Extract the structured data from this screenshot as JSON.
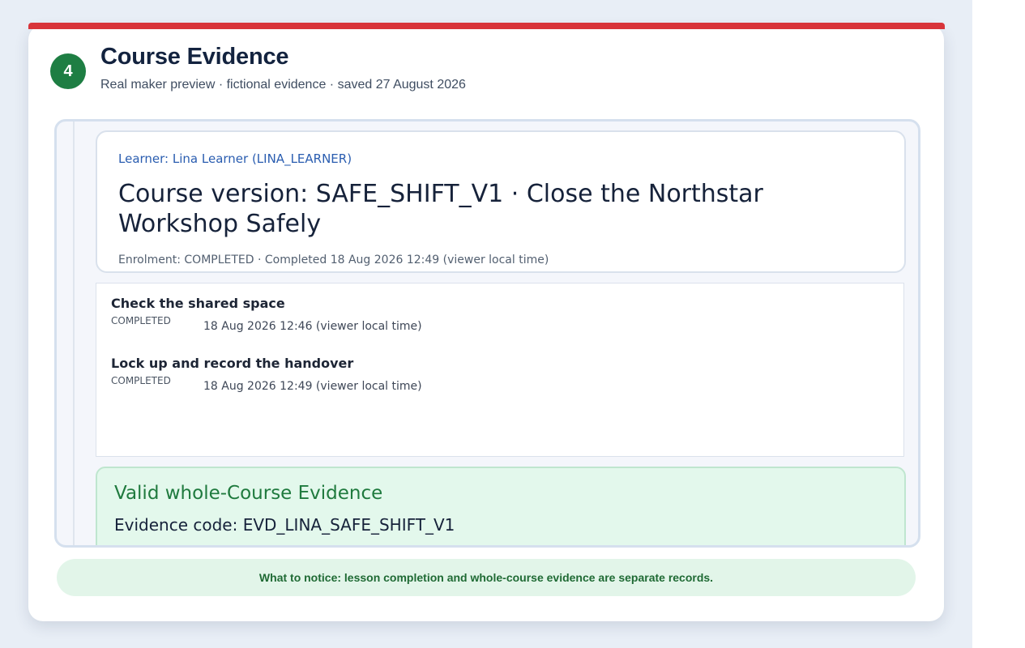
{
  "step": {
    "number": "4"
  },
  "page": {
    "title": "Course Evidence",
    "subtitle": "Real maker preview · fictional evidence · saved 27 August 2026"
  },
  "header": {
    "learner": "Learner: Lina Learner (LINA_LEARNER)",
    "course_version": "Course version: SAFE_SHIFT_V1 · Close the Northstar Workshop Safely",
    "enrolment": "Enrolment: COMPLETED · Completed 18 Aug 2026 12:49 (viewer local time)"
  },
  "lessons": [
    {
      "title": "Check the shared space",
      "status": "COMPLETED",
      "time": "18 Aug 2026 12:46 (viewer local time)"
    },
    {
      "title": "Lock up and record the handover",
      "status": "COMPLETED",
      "time": "18 Aug 2026 12:49 (viewer local time)"
    }
  ],
  "evidence": {
    "title": "Valid whole-Course Evidence",
    "code": "Evidence code: EVD_LINA_SAFE_SHIFT_V1"
  },
  "notice": "What to notice: lesson completion and whole-course evidence are separate records.",
  "colors": {
    "accent_bar": "#d8343a",
    "step_badge": "#1e7e43",
    "evidence_bg": "#e3f8ec",
    "evidence_title": "#1f7a3e",
    "learner_link": "#2a5db0"
  }
}
